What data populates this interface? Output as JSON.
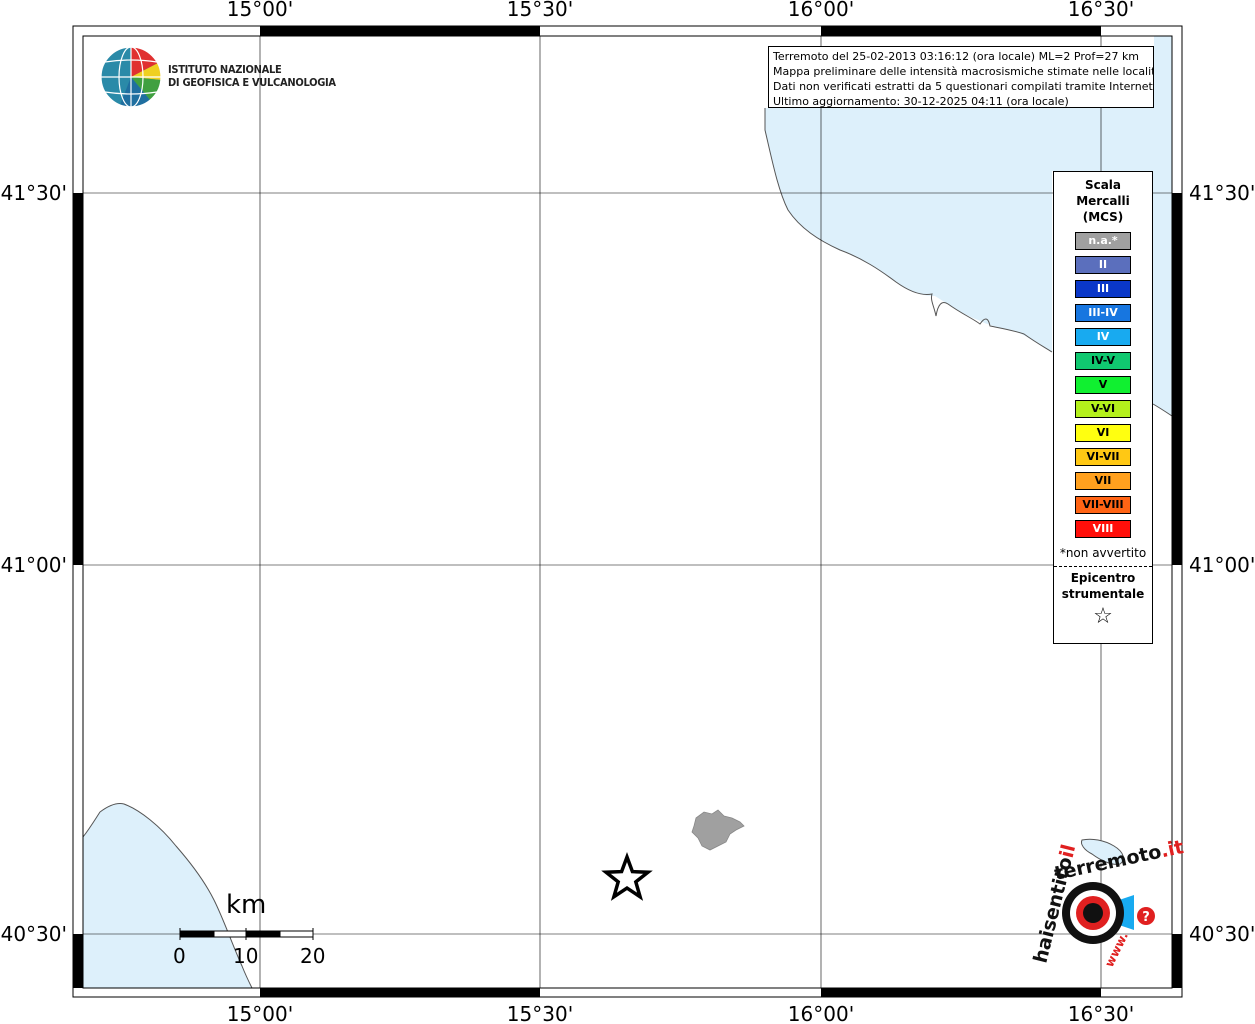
{
  "map": {
    "top_lon_labels": [
      "15°00'",
      "15°30'",
      "16°00'",
      "16°30'"
    ],
    "bottom_lon_labels": [
      "15°00'",
      "15°30'",
      "16°00'",
      "16°30'"
    ],
    "left_lat_labels": [
      "41°30'",
      "41°00'",
      "40°30'"
    ],
    "right_lat_labels": [
      "41°30'",
      "41°00'",
      "40°30'"
    ],
    "sea_color": "#ddf0fb",
    "coast_color": "#555555",
    "locality_color": "#a0a0a0",
    "epicenter_symbol": "star"
  },
  "logo": {
    "line1": "ISTITUTO NAZIONALE",
    "line2": "DI GEOFISICA E VULCANOLOGIA"
  },
  "info": {
    "line1": "Terremoto del 25-02-2013 03:16:12 (ora locale) ML=2 Prof=27 km",
    "line2": "Mappa preliminare delle intensità macrosismiche stimate nelle località",
    "line3": "Dati non verificati estratti da 5 questionari compilati tramite Internet.",
    "line4": "Ultimo aggiornamento: 30-12-2025 04:11 (ora locale)"
  },
  "legend": {
    "title1": "Scala",
    "title2": "Mercalli",
    "title3": "(MCS)",
    "items": [
      {
        "label": "n.a.*",
        "color": "#a0a0a0"
      },
      {
        "label": "II",
        "color": "#5b6fbd"
      },
      {
        "label": "III",
        "color": "#0a37c8"
      },
      {
        "label": "III-IV",
        "color": "#1776e0"
      },
      {
        "label": "IV",
        "color": "#18aaf0"
      },
      {
        "label": "IV-V",
        "color": "#10c870"
      },
      {
        "label": "V",
        "color": "#10f030"
      },
      {
        "label": "V-VI",
        "color": "#b4f01c"
      },
      {
        "label": "VI",
        "color": "#ffff10"
      },
      {
        "label": "VI-VII",
        "color": "#ffc814"
      },
      {
        "label": "VII",
        "color": "#ffa01e"
      },
      {
        "label": "VII-VIII",
        "color": "#ff6414"
      },
      {
        "label": "VIII",
        "color": "#ff0f0a"
      }
    ],
    "note": "*non avvertito",
    "epi1": "Epicentro",
    "epi2": "strumentale",
    "epi_symbol": "☆"
  },
  "scale_bar": {
    "unit": "km",
    "labels": [
      "0",
      "10",
      "20"
    ]
  },
  "badge": {
    "text_dark": "haisentito",
    "text_il": "il",
    "text_terremoto": "terremoto",
    "text_it": ".it",
    "text_www": "www.",
    "question": "?"
  }
}
